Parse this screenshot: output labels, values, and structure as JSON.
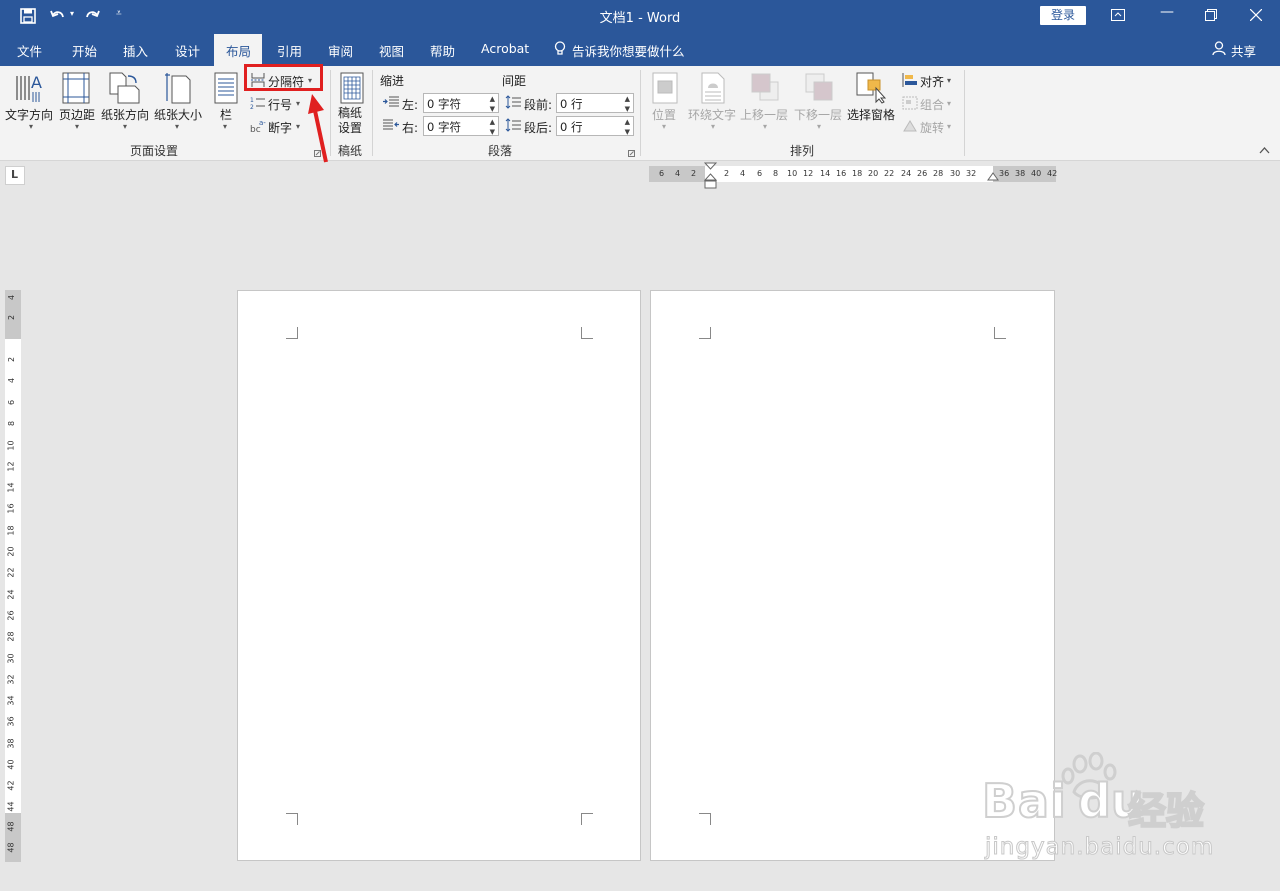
{
  "window": {
    "title": "文档1  -  Word",
    "login_label": "登录"
  },
  "quick_access": {
    "save": "save-icon",
    "undo": "undo-icon",
    "redo": "redo-icon",
    "customize": "customize-icon"
  },
  "tabs": [
    "文件",
    "开始",
    "插入",
    "设计",
    "布局",
    "引用",
    "审阅",
    "视图",
    "帮助",
    "Acrobat"
  ],
  "active_tab": "布局",
  "tell_me": "告诉我你想要做什么",
  "share": "共享",
  "page_setup": {
    "group_label": "页面设置",
    "text_direction": "文字方向",
    "margins": "页边距",
    "orientation": "纸张方向",
    "size": "纸张大小",
    "columns": "栏",
    "breaks": "分隔符",
    "line_numbers": "行号",
    "hyphenation": "断字"
  },
  "manuscript": {
    "group_label": "稿纸",
    "button_line1": "稿纸",
    "button_line2": "设置"
  },
  "paragraph": {
    "group_label": "段落",
    "indent_header": "缩进",
    "spacing_header": "间距",
    "left_label": "左:",
    "right_label": "右:",
    "left_value": "0 字符",
    "right_value": "0 字符",
    "before_label": "段前:",
    "after_label": "段后:",
    "before_value": "0 行",
    "after_value": "0 行"
  },
  "arrange": {
    "group_label": "排列",
    "position": "位置",
    "wrap_text": "环绕文字",
    "bring_forward": "上移一层",
    "send_backward": "下移一层",
    "selection_pane": "选择窗格",
    "align": "对齐",
    "group": "组合",
    "rotate": "旋转"
  },
  "ruler": {
    "h_left_numbers": [
      "6",
      "4",
      "2"
    ],
    "h_numbers": [
      "2",
      "4",
      "6",
      "8",
      "10",
      "12",
      "14",
      "16",
      "18",
      "20",
      "22",
      "24",
      "26",
      "28",
      "30",
      "32"
    ],
    "h_right_numbers": [
      "36",
      "38",
      "40",
      "42"
    ],
    "v_top_numbers": [
      "4",
      "2"
    ],
    "v_numbers": [
      "2",
      "4",
      "6",
      "8",
      "10",
      "12",
      "14",
      "16",
      "18",
      "20",
      "22",
      "24",
      "26",
      "28",
      "30",
      "32",
      "34",
      "36",
      "38",
      "40",
      "42",
      "44"
    ],
    "v_bottom_numbers": [
      "48"
    ],
    "tab_selector": "L"
  },
  "watermark": {
    "brand": "Bai",
    "brand2": "du",
    "brand_cn": "经验",
    "url": "jingyan.baidu.com"
  },
  "colors": {
    "title_bar": "#2b579a",
    "highlight_box": "#e02020",
    "arrow": "#e02020"
  }
}
